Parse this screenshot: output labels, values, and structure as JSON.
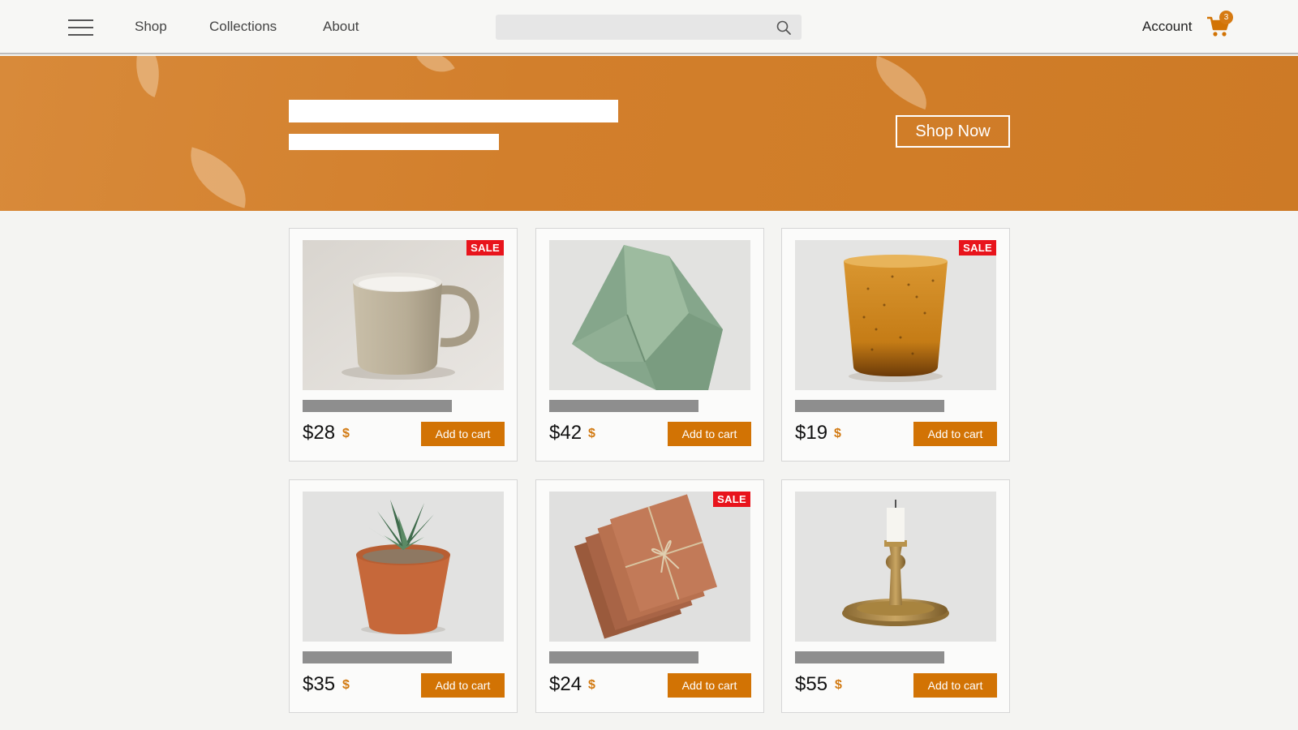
{
  "header": {
    "nav": [
      "Shop",
      "Collections",
      "About"
    ],
    "search_placeholder": "",
    "account_label": "Account",
    "cart_count": "3"
  },
  "hero": {
    "cta_label": "Shop Now"
  },
  "products": [
    {
      "price": "$28",
      "sale": "SALE",
      "add_label": "Add to cart",
      "image": "ceramic-mug"
    },
    {
      "price": "$42",
      "sale": "",
      "add_label": "Add to cart",
      "image": "green-linen-napkin"
    },
    {
      "price": "$19",
      "sale": "SALE",
      "add_label": "Add to cart",
      "image": "amber-glass-tumbler"
    },
    {
      "price": "$35",
      "sale": "",
      "add_label": "Add to cart",
      "image": "potted-succulent"
    },
    {
      "price": "$24",
      "sale": "SALE",
      "add_label": "Add to cart",
      "image": "kraft-notebooks"
    },
    {
      "price": "$55",
      "sale": "",
      "add_label": "Add to cart",
      "image": "brass-candlestick"
    }
  ],
  "price_icon": "$",
  "colors": {
    "accent": "#d27304",
    "hero": "#d27f2c",
    "sale": "#e8141c"
  }
}
